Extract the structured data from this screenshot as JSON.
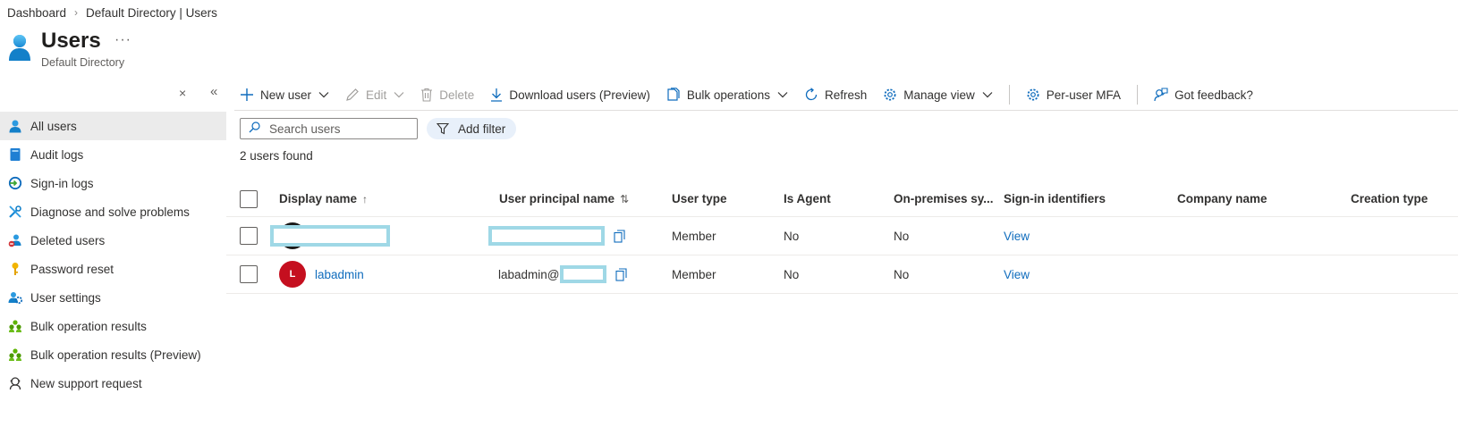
{
  "breadcrumb": {
    "items": [
      "Dashboard",
      "Default Directory | Users"
    ],
    "separator": "›"
  },
  "header": {
    "title": "Users",
    "subtitle": "Default Directory",
    "more": "···"
  },
  "sidebar_controls": {
    "close_glyph": "×",
    "collapse_glyph": "«"
  },
  "sidebar": {
    "items": [
      {
        "label": "All users",
        "icon": "user-icon",
        "active": true
      },
      {
        "label": "Audit logs",
        "icon": "book-icon"
      },
      {
        "label": "Sign-in logs",
        "icon": "signin-icon"
      },
      {
        "label": "Diagnose and solve problems",
        "icon": "wrench-icon"
      },
      {
        "label": "Deleted users",
        "icon": "deleted-user-icon"
      },
      {
        "label": "Password reset",
        "icon": "key-icon"
      },
      {
        "label": "User settings",
        "icon": "user-gear-icon"
      },
      {
        "label": "Bulk operation results",
        "icon": "group-icon"
      },
      {
        "label": "Bulk operation results (Preview)",
        "icon": "group-icon"
      },
      {
        "label": "New support request",
        "icon": "support-icon"
      }
    ]
  },
  "toolbar": {
    "new_user": "New user",
    "edit": "Edit",
    "delete": "Delete",
    "download": "Download users (Preview)",
    "bulk": "Bulk operations",
    "refresh": "Refresh",
    "manage_view": "Manage view",
    "per_user_mfa": "Per-user MFA",
    "feedback": "Got feedback?"
  },
  "search": {
    "placeholder": "Search users",
    "value": ""
  },
  "filter": {
    "label": "Add filter"
  },
  "results": {
    "count_text": "2 users found"
  },
  "table": {
    "columns": {
      "display_name": "Display name",
      "display_name_sort": "↑",
      "upn": "User principal name",
      "upn_sort": "⇅",
      "user_type": "User type",
      "is_agent": "Is Agent",
      "on_prem": "On-premises sy...",
      "sign_in_ids": "Sign-in identifiers",
      "company": "Company name",
      "creation": "Creation type"
    },
    "rows": [
      {
        "avatar_initial": "",
        "avatar_color": "#1b1a19",
        "display_name": "",
        "upn": "",
        "user_type": "Member",
        "is_agent": "No",
        "on_prem": "No",
        "sign_in_ids": "View",
        "company": "",
        "creation": ""
      },
      {
        "avatar_initial": "L",
        "avatar_color": "#c50f1f",
        "display_name": "labadmin",
        "upn": "labadmin@",
        "user_type": "Member",
        "is_agent": "No",
        "on_prem": "No",
        "sign_in_ids": "View",
        "company": "",
        "creation": ""
      }
    ]
  },
  "colors": {
    "accent": "#0f6cbd",
    "redaction": "#9fd8e6",
    "active_nav_bg": "#ebebeb",
    "filter_pill_bg": "#e8f0fa"
  }
}
